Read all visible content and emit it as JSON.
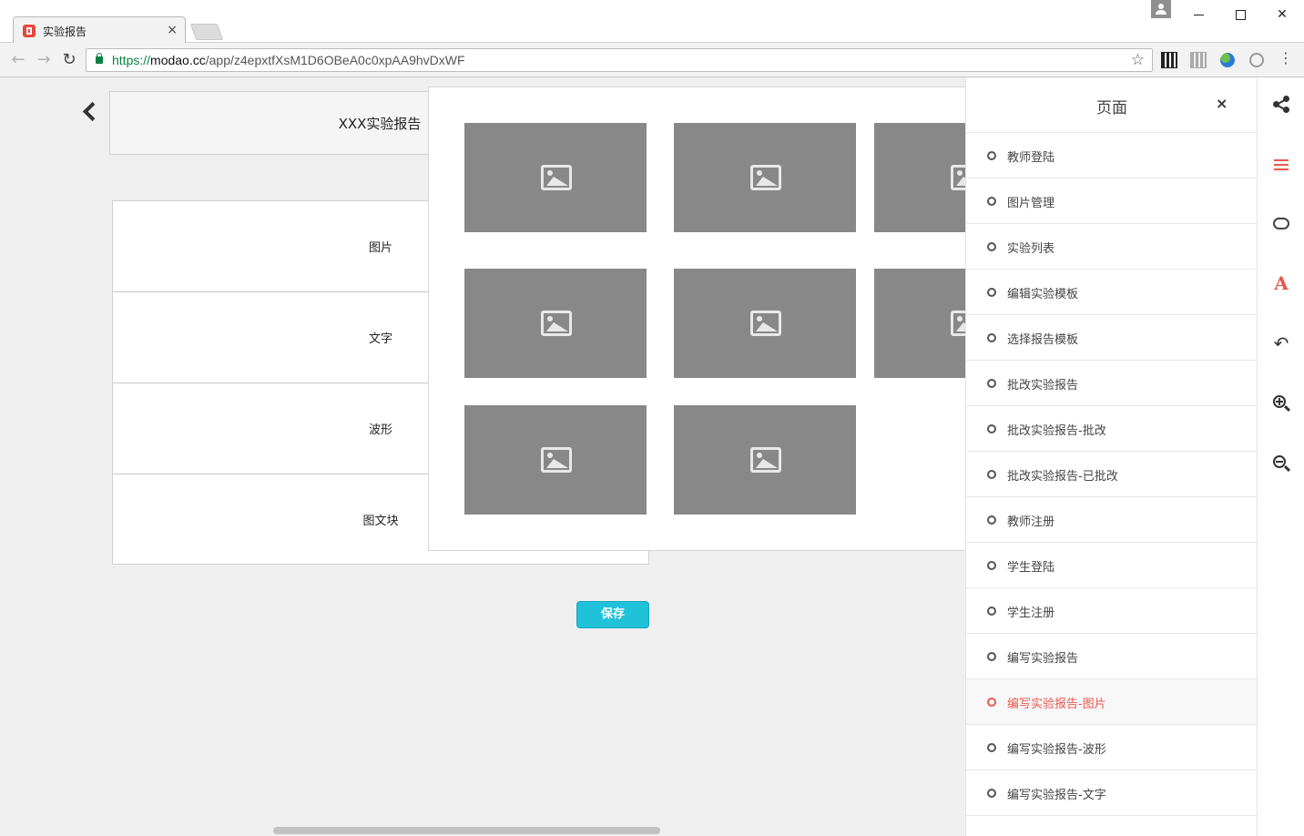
{
  "browser": {
    "tab_title": "实验报告",
    "tab_close": "×",
    "url_scheme": "https://",
    "url_host": "modao.cc",
    "url_path": "/app/z4epxtfXsM1D6OBeA0c0xpAA9hvDxWF",
    "icons": {
      "back": "←",
      "forward": "→",
      "reload": "↻",
      "bookmark": "☆",
      "menu": "⋮",
      "window_close": "✕"
    }
  },
  "page": {
    "header_title": "XXX实验报告",
    "blocks": [
      "图片",
      "文字",
      "波形",
      "图文块"
    ],
    "save_label": "保存"
  },
  "picker": {
    "image_count": 8
  },
  "pages_panel": {
    "title": "页面",
    "close": "×",
    "items": [
      "教师登陆",
      "图片管理",
      "实验列表",
      "编辑实验模板",
      "选择报告模板",
      "批改实验报告",
      "批改实验报告-批改",
      "批改实验报告-已批改",
      "教师注册",
      "学生登陆",
      "学生注册",
      "编写实验报告",
      "编写实验报告-图片",
      "编写实验报告-波形",
      "编写实验报告-文字"
    ],
    "active_item": "编写实验报告-图片"
  },
  "tool_rail": {
    "font_glyph": "A",
    "undo_glyph": "↶"
  },
  "colors": {
    "accent_red": "#e8594e",
    "save_button": "#1fc2d9",
    "placeholder_gray": "#888888"
  }
}
